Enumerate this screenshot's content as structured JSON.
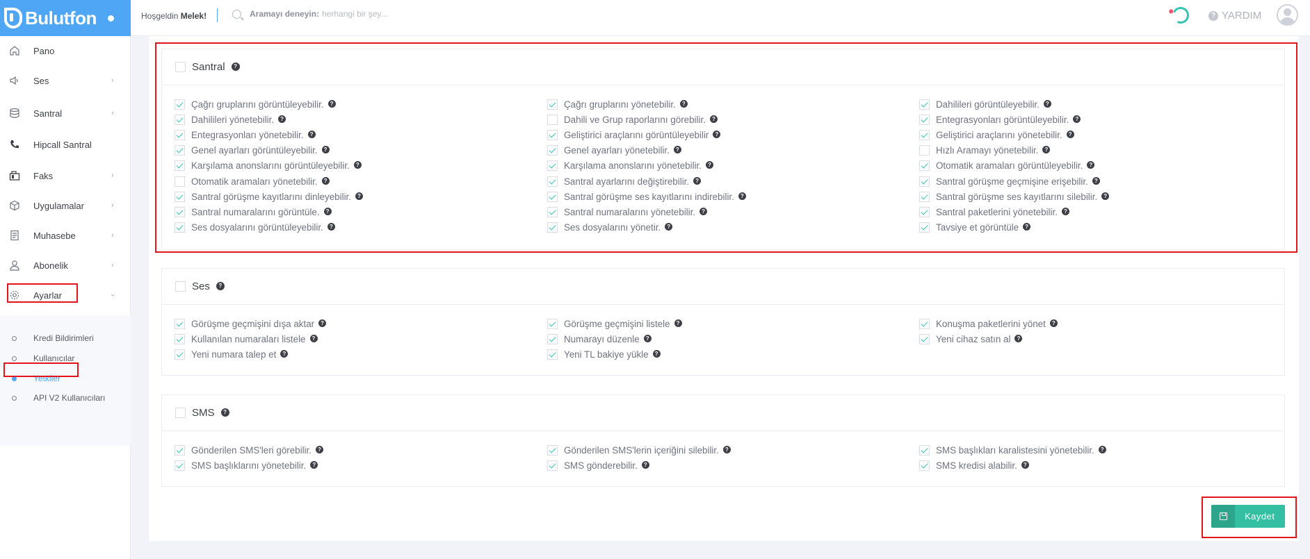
{
  "header": {
    "logo_text": "Bulutfon",
    "welcome_prefix": "Hoşgeldin",
    "user_name": "Melek!",
    "search_label": "Aramayı deneyin:",
    "search_placeholder": "herhangi bir şey...",
    "help_label": "YARDIM",
    "help_glyph": "?"
  },
  "sidebar": {
    "items": [
      {
        "label": "Pano",
        "icon": "home-icon"
      },
      {
        "label": "Ses",
        "icon": "speaker-icon"
      },
      {
        "label": "Santral",
        "icon": "database-icon"
      },
      {
        "label": "Hipcall Santral",
        "icon": "phone-icon"
      },
      {
        "label": "Faks",
        "icon": "fax-icon"
      },
      {
        "label": "Uygulamalar",
        "icon": "box-icon"
      },
      {
        "label": "Muhasebe",
        "icon": "receipt-icon"
      },
      {
        "label": "Abonelik",
        "icon": "user-icon"
      },
      {
        "label": "Ayarlar",
        "icon": "gear-icon"
      }
    ],
    "submenu": [
      {
        "label": "Kredi Bildirimleri",
        "active": false
      },
      {
        "label": "Kullanıcılar",
        "active": false
      },
      {
        "label": "Yetkiler",
        "active": true
      },
      {
        "label": "API V2 Kullanıcıları",
        "active": false
      }
    ]
  },
  "sections": [
    {
      "title": "Santral",
      "checked": false,
      "permissions": [
        {
          "label": "Çağrı gruplarını görüntüleyebilir.",
          "checked": true
        },
        {
          "label": "Çağrı gruplarını yönetebilir.",
          "checked": true
        },
        {
          "label": "Dahilileri görüntüleyebilir.",
          "checked": true
        },
        {
          "label": "Dahilileri yönetebilir.",
          "checked": true
        },
        {
          "label": "Dahili ve Grup raporlarını görebilir.",
          "checked": false
        },
        {
          "label": "Entegrasyonları görüntüleyebilir.",
          "checked": true
        },
        {
          "label": "Entegrasyonları yönetebilir.",
          "checked": true
        },
        {
          "label": "Geliştirici araçlarını görüntüleyebilir",
          "checked": true
        },
        {
          "label": "Geliştirici araçlarını yönetebilir.",
          "checked": true
        },
        {
          "label": "Genel ayarları görüntüleyebilir.",
          "checked": true
        },
        {
          "label": "Genel ayarları yönetebilir.",
          "checked": true
        },
        {
          "label": "Hızlı Aramayı yönetebilir.",
          "checked": false
        },
        {
          "label": "Karşılama anonslarını görüntüleyebilir.",
          "checked": true
        },
        {
          "label": "Karşılama anonslarını yönetebilir.",
          "checked": true
        },
        {
          "label": "Otomatik aramaları görüntüleyebilir.",
          "checked": true
        },
        {
          "label": "Otomatik aramaları yönetebilir.",
          "checked": false
        },
        {
          "label": "Santral ayarlarını değiştirebilir.",
          "checked": true
        },
        {
          "label": "Santral görüşme geçmişine erişebilir.",
          "checked": true
        },
        {
          "label": "Santral görüşme kayıtlarını dinleyebilir.",
          "checked": true
        },
        {
          "label": "Santral görüşme ses kayıtlarını indirebilir.",
          "checked": true
        },
        {
          "label": "Santral görüşme ses kayıtlarını silebilir.",
          "checked": true
        },
        {
          "label": "Santral numaralarını görüntüle.",
          "checked": true
        },
        {
          "label": "Santral numaralarını yönetebilir.",
          "checked": true
        },
        {
          "label": "Santral paketlerini yönetebilir.",
          "checked": true
        },
        {
          "label": "Ses dosyalarını görüntüleyebilir.",
          "checked": true
        },
        {
          "label": "Ses dosyalarını yönetir.",
          "checked": true
        },
        {
          "label": "Tavsiye et görüntüle",
          "checked": true
        }
      ]
    },
    {
      "title": "Ses",
      "checked": false,
      "permissions": [
        {
          "label": "Görüşme geçmişini dışa aktar",
          "checked": true
        },
        {
          "label": "Görüşme geçmişini listele",
          "checked": true
        },
        {
          "label": "Konuşma paketlerini yönet",
          "checked": true
        },
        {
          "label": "Kullanılan numaraları listele",
          "checked": true
        },
        {
          "label": "Numarayı düzenle",
          "checked": true
        },
        {
          "label": "Yeni cihaz satın al",
          "checked": true
        },
        {
          "label": "Yeni numara talep et",
          "checked": true
        },
        {
          "label": "Yeni TL bakiye yükle",
          "checked": true
        }
      ]
    },
    {
      "title": "SMS",
      "checked": false,
      "permissions": [
        {
          "label": "Gönderilen SMS'leri görebilir.",
          "checked": true
        },
        {
          "label": "Gönderilen SMS'lerin içeriğini silebilir.",
          "checked": true
        },
        {
          "label": "SMS başlıkları karalistesini yönetebilir.",
          "checked": true
        },
        {
          "label": "SMS başlıklarını yönetebilir.",
          "checked": true
        },
        {
          "label": "SMS gönderebilir.",
          "checked": true
        },
        {
          "label": "SMS kredisi alabilir.",
          "checked": true
        }
      ]
    }
  ],
  "save_button": {
    "label": "Kaydet"
  }
}
